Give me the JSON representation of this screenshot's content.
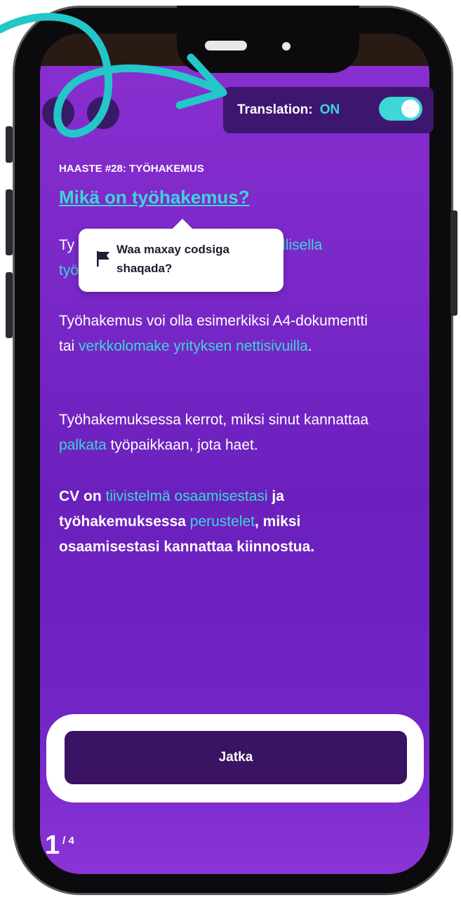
{
  "header": {
    "translation_label": "Translation:",
    "translation_state": "ON",
    "translation_on": true,
    "prev_icon": "chevron-left-icon",
    "next_icon": "chevron-right-icon"
  },
  "content": {
    "challenge_label": "HAASTE #28: TYÖHAKEMUS",
    "title": "Mikä on työhakemus?",
    "para1": {
      "start": "Ty",
      "highlight": "irjallisella",
      "line2_highlight": "työ"
    },
    "para2": {
      "text": "Työhakemus voi olla esimerkiksi A4-dokumentti tai ",
      "highlight": "verkkolomake yrityksen nettisivuilla",
      "end": "."
    },
    "para3": {
      "text": "Työhakemuksessa kerrot, miksi sinut kannattaa ",
      "highlight": "palkata",
      "end": " työpaikkaan, jota haet."
    },
    "para4": {
      "start": "CV on ",
      "highlight1": "tiivistelmä osaamisestasi",
      "mid": " ja työhakemuksessa ",
      "highlight2": "perustelet",
      "end": ", miksi osaamisestasi kannattaa kiinnostua."
    }
  },
  "popup": {
    "icon": "flag-icon",
    "text": "Waa maxay codsiga shaqada?"
  },
  "footer": {
    "cta_label": "Jatka",
    "progress_current": "1",
    "progress_total": "/ 4"
  },
  "colors": {
    "accent": "#3ed6d6",
    "background": "#7a28c8",
    "button": "#3b1364"
  }
}
